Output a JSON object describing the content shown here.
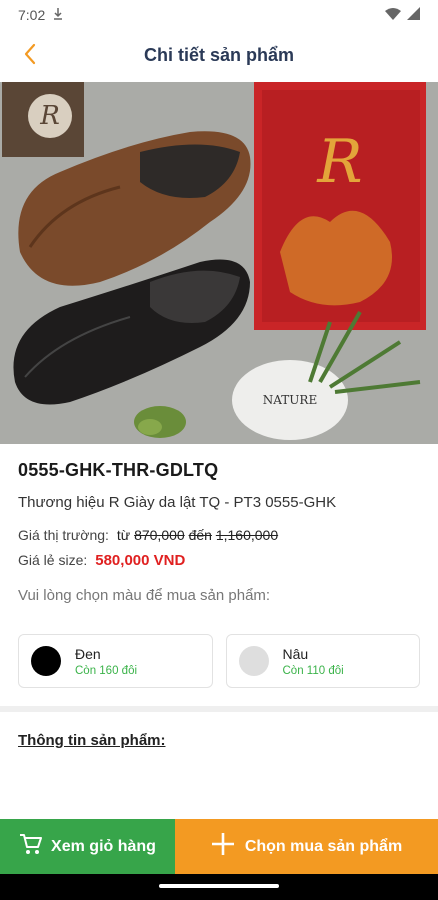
{
  "status_bar": {
    "time": "7:02"
  },
  "header": {
    "title": "Chi tiết sản phẩm"
  },
  "product": {
    "sku": "0555-GHK-THR-GDLTQ",
    "brand_line": "Thương hiệu R Giày da lật TQ - PT3 0555-GHK",
    "market_price_label": "Giá thị trường:",
    "market_price_from": "từ",
    "market_price_min": "870,000",
    "market_price_to": "đến",
    "market_price_max": "1,160,000",
    "retail_label": "Giá lẻ size:",
    "retail_price": "580,000 VND",
    "choose_color_prompt": "Vui lòng chọn màu để mua sản phẩm:"
  },
  "colors": [
    {
      "name": "Đen",
      "stock": "Còn 160 đôi",
      "swatch": "#000000"
    },
    {
      "name": "Nâu",
      "stock": "Còn 110 đôi",
      "swatch": "#dedede"
    }
  ],
  "sections": {
    "product_info_title": "Thông tin sản phẩm:"
  },
  "actions": {
    "cart_label": "Xem giỏ hàng",
    "buy_label": "Chọn mua sản phẩm"
  },
  "theme": {
    "green": "#37a54a",
    "orange": "#f39a22",
    "price_red": "#e02020",
    "stock_green": "#3bb34a",
    "back_arrow": "#f39a22"
  },
  "icons": {
    "back": "chevron-left-icon",
    "cart": "cart-icon",
    "add": "plus-icon",
    "wifi": "wifi-icon",
    "signal": "signal-icon",
    "download": "download-icon"
  }
}
